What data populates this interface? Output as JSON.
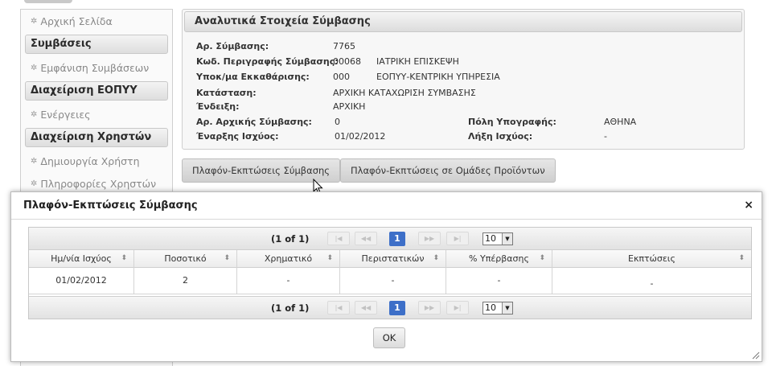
{
  "sidebar": {
    "home": "Αρχική Σελίδα",
    "group_contracts": "Συμβάσεις",
    "show_contracts": "Εμφάνιση Συμβάσεων",
    "group_eopyy": "Διαχείριση ΕΟΠΥΥ",
    "actions": "Ενέργειες",
    "group_users": "Διαχείριση Χρηστών",
    "create_user": "Δημιουργία Χρήστη",
    "user_info": "Πληροφορίες Χρηστών"
  },
  "details": {
    "title": "Αναλυτικά Στοιχεία Σύμβασης",
    "contract_no_label": "Αρ. Σύμβασης:",
    "contract_no": "7765",
    "desc_code_label": "Κωδ. Περιγραφής Σύμβασης:",
    "desc_code": "00068",
    "desc_text": "ΙΑΤΡΙΚΗ ΕΠΙΣΚΕΨΗ",
    "settlement_label": "Υποκ/μα Εκκαθάρισης:",
    "settlement_code": "000",
    "settlement_text": "ΕΟΠΥΥ-ΚΕΝΤΡΙΚΗ ΥΠΗΡΕΣΙΑ",
    "status_label": "Κατάσταση:",
    "status": "ΑΡΧΙΚΗ ΚΑΤΑΧΩΡΙΣΗ ΣΥΜΒΑΣΗΣ",
    "indication_label": "Ένδειξη:",
    "indication": "ΑΡΧΙΚΗ",
    "initial_no_label": "Αρ. Αρχικής Σύμβασης:",
    "initial_no": "0",
    "city_label": "Πόλη Υπογραφής:",
    "city": "ΑΘΗΝΑ",
    "start_label": "Έναρξης Ισχύος:",
    "start": "01/02/2012",
    "end_label": "Λήξη Ισχύος:",
    "end": "-"
  },
  "tabs": {
    "ceilings": "Πλαφόν-Εκπτώσεις Σύμβασης",
    "ceilings_groups": "Πλαφόν-Εκπτώσεις σε Ομάδες Προϊόντων"
  },
  "dialog": {
    "title": "Πλαφόν-Εκπτώσεις Σύμβασης",
    "close_symbol": "×",
    "ok": "OK",
    "pager": {
      "status": "(1 of 1)",
      "current_page": "1",
      "rows_per_page": "10",
      "first": "|◀",
      "prev": "◀◀",
      "next": "▶▶",
      "last": "▶|"
    },
    "columns": [
      "Ημ/νία Ισχύος",
      "Ποσοτικό",
      "Χρηματικό",
      "Περιστατικών",
      "% Υπέρβασης",
      "Εκπτώσεις"
    ],
    "rows": [
      [
        "01/02/2012",
        "2",
        "-",
        "-",
        "-",
        "-"
      ]
    ]
  }
}
